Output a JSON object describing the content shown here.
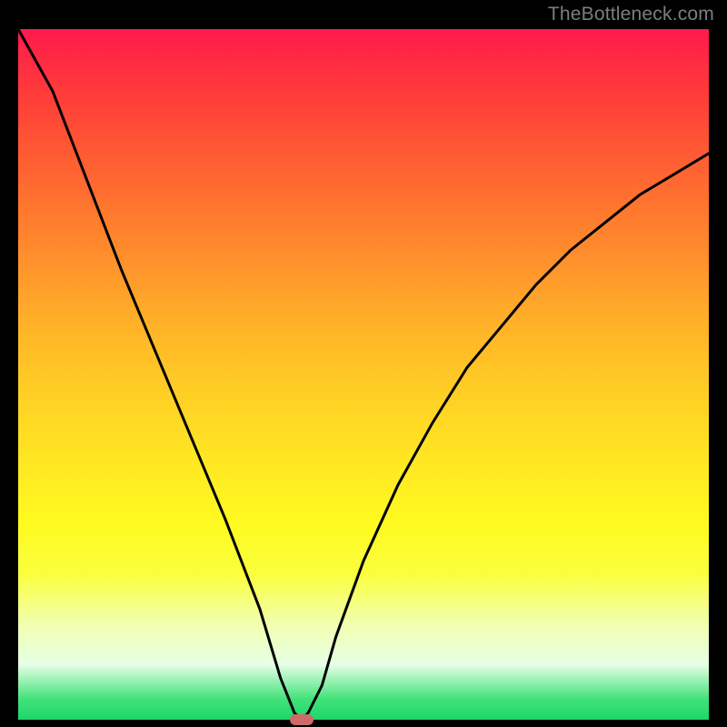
{
  "watermark": "TheBottleneck.com",
  "chart_data": {
    "type": "line",
    "title": "",
    "xlabel": "",
    "ylabel": "",
    "xlim": [
      0,
      1
    ],
    "ylim": [
      0,
      1
    ],
    "grid": false,
    "legend": false,
    "series": [
      {
        "name": "bottleneck-curve",
        "x": [
          0.0,
          0.05,
          0.1,
          0.15,
          0.2,
          0.25,
          0.3,
          0.35,
          0.38,
          0.4,
          0.41,
          0.42,
          0.44,
          0.46,
          0.5,
          0.55,
          0.6,
          0.65,
          0.7,
          0.75,
          0.8,
          0.85,
          0.9,
          0.95,
          1.0
        ],
        "y": [
          1.05,
          0.91,
          0.78,
          0.65,
          0.53,
          0.41,
          0.29,
          0.16,
          0.06,
          0.01,
          0.0,
          0.01,
          0.05,
          0.12,
          0.23,
          0.34,
          0.43,
          0.51,
          0.57,
          0.63,
          0.68,
          0.72,
          0.76,
          0.79,
          0.82
        ]
      }
    ],
    "marker": {
      "x": 0.41,
      "y": 0.0,
      "color": "#cf6a6a"
    },
    "gradient_background": {
      "top": "#ff1a4c",
      "middle": "#ffe822",
      "bottom": "#1bd66a"
    }
  }
}
